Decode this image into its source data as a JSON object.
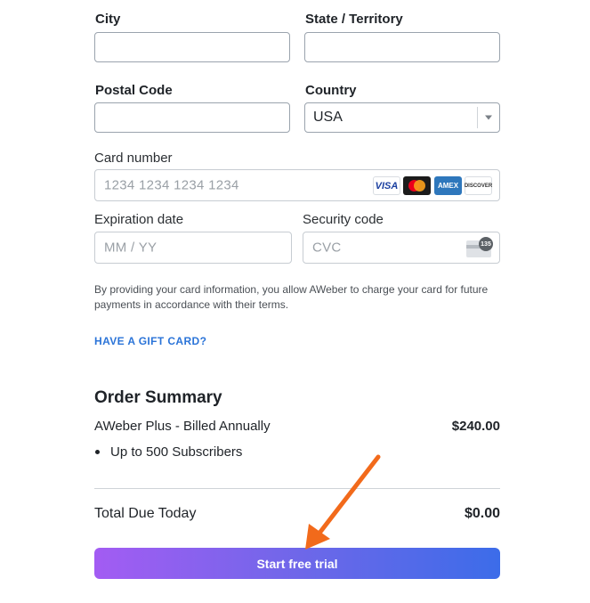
{
  "address": {
    "city_label": "City",
    "state_label": "State / Territory",
    "postal_label": "Postal Code",
    "country_label": "Country",
    "country_value": "USA"
  },
  "card": {
    "number_label": "Card number",
    "number_placeholder": "1234 1234 1234 1234",
    "brands": [
      "visa",
      "mastercard",
      "amex",
      "discover"
    ],
    "visa_text": "VISA",
    "amex_text": "AMEX",
    "discover_text": "DISCOVER",
    "expiry_label": "Expiration date",
    "expiry_placeholder": "MM / YY",
    "cvc_label": "Security code",
    "cvc_placeholder": "CVC",
    "cvc_badge": "135",
    "consent_text": "By providing your card information, you allow AWeber to charge your card for future payments in accordance with their terms."
  },
  "gift_link": "HAVE A GIFT CARD?",
  "summary": {
    "title": "Order Summary",
    "plan_name": "AWeber Plus - Billed Annually",
    "plan_price": "$240.00",
    "features": [
      "Up to 500 Subscribers"
    ],
    "total_label": "Total Due Today",
    "total_value": "$0.00"
  },
  "cta": {
    "label": "Start free trial"
  },
  "colors": {
    "link": "#2b74d8",
    "button_gradient_start": "#a35cf3",
    "button_gradient_end": "#3c6ce9",
    "annotation_arrow": "#f26a1b"
  }
}
